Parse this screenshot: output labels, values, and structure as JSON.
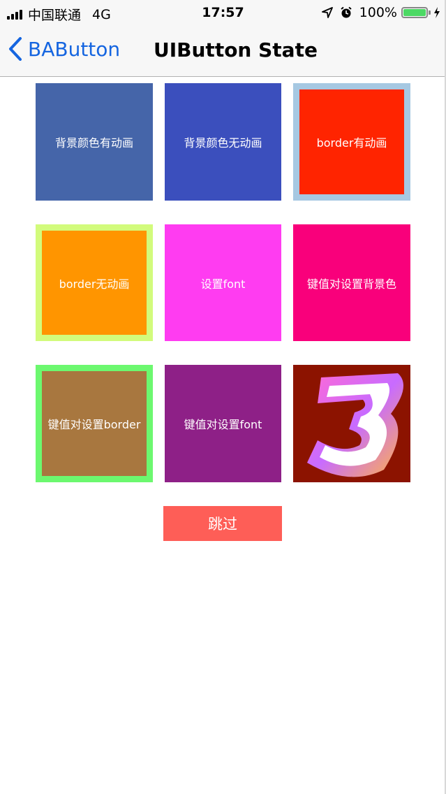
{
  "status_bar": {
    "carrier": "中国联通",
    "network": "4G",
    "time": "17:57",
    "battery_percent": "100%",
    "icons": [
      "signal-icon",
      "location-icon",
      "alarm-icon",
      "battery-icon",
      "charging-icon"
    ]
  },
  "nav": {
    "back_label": "BAButton",
    "title": "UIButton State"
  },
  "tiles": [
    {
      "label": "背景颜色有动画",
      "color": "#4565a9"
    },
    {
      "label": "背景颜色无动画",
      "color": "#3b4fbd"
    },
    {
      "label": "border有动画",
      "color": "#ff2400",
      "border_color": "#a6c8e2"
    },
    {
      "label": "border无动画",
      "color": "#ff9500",
      "border_color": "#d2fb7c"
    },
    {
      "label": "设置font",
      "color": "#ff3cf1"
    },
    {
      "label": "键值对设置背景色",
      "color": "#f9007b"
    },
    {
      "label": "键值对设置border",
      "color": "#a8773f",
      "border_color": "#6cf86f"
    },
    {
      "label": "键值对设置font",
      "color": "#8e2087"
    },
    {
      "label": "3",
      "color": "#8c1300",
      "image": "number-three-image"
    }
  ],
  "skip_button": {
    "label": "跳过",
    "color": "#fe5e57"
  }
}
